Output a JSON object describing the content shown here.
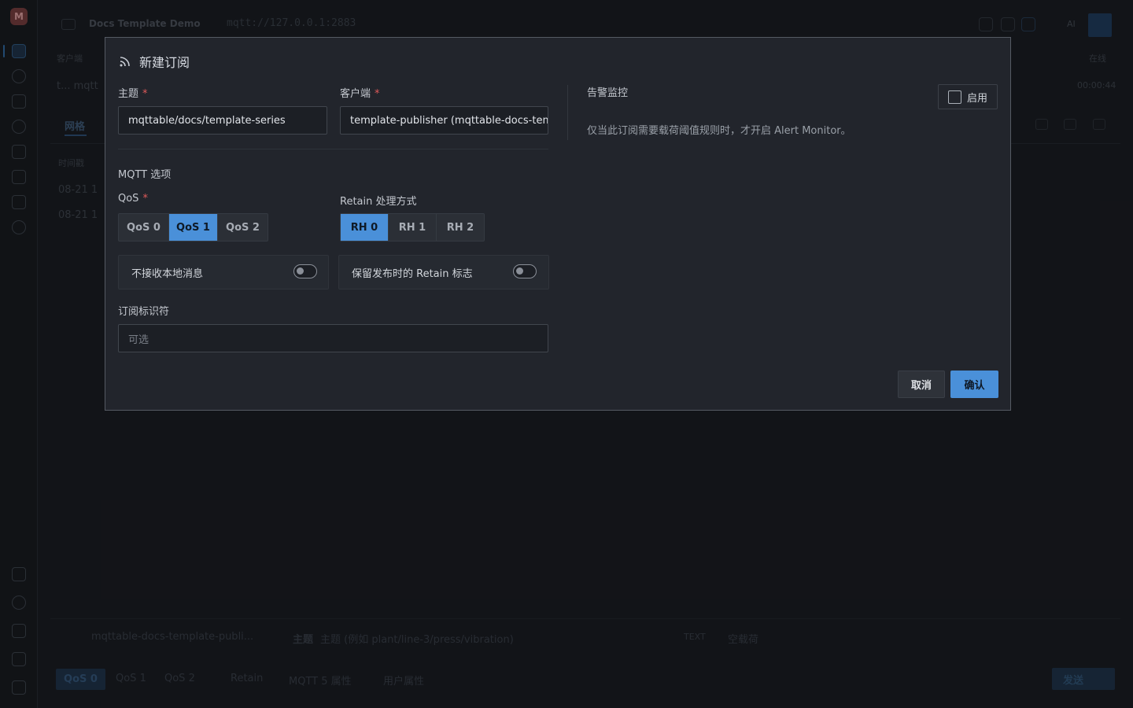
{
  "app": {
    "window_title": "Docs Template Demo",
    "url": "mqtt://127.0.0.1:2883",
    "ai_label": "AI",
    "client_section_label": "客户端",
    "client_short": "t... mqtt",
    "status_label": "在线",
    "elapsed": "00:00:44",
    "tabs": {
      "active": "网格"
    },
    "table": {
      "col_time": "时间戳",
      "row1": "08-21 1",
      "row2": "08-21 1"
    }
  },
  "composer": {
    "client": "mqttable-docs-template-publi...",
    "topic_label": "主题",
    "topic_placeholder": "主题 (例如 plant/line-3/press/vibration)",
    "format": "TEXT",
    "payload_placeholder": "空载荷",
    "qos_options": [
      "QoS 0",
      "QoS 1",
      "QoS 2"
    ],
    "retain": "Retain",
    "mqtt5_props": "MQTT 5 属性",
    "user_props": "用户属性",
    "send": "发送"
  },
  "dialog": {
    "title": "新建订阅",
    "topic": {
      "label": "主题",
      "required_mark": "*",
      "value": "mqttable/docs/template-series"
    },
    "client": {
      "label": "客户端",
      "required_mark": "*",
      "value": "template-publisher (mqttable-docs-tem"
    },
    "mqtt_section": "MQTT 选项",
    "qos": {
      "label": "QoS",
      "required_mark": "*",
      "options": [
        "QoS 0",
        "QoS 1",
        "QoS 2"
      ],
      "selected": "QoS 1"
    },
    "retain_handling": {
      "label": "Retain 处理方式",
      "options": [
        "RH 0",
        "RH 1",
        "RH 2"
      ],
      "selected": "RH 0"
    },
    "no_local": {
      "label": "不接收本地消息",
      "enabled": false
    },
    "retain_as_published": {
      "label": "保留发布时的 Retain 标志",
      "enabled": false
    },
    "sub_id": {
      "label": "订阅标识符",
      "placeholder": "可选"
    },
    "alert": {
      "title": "告警监控",
      "enable_label": "启用",
      "enabled": false,
      "description": "仅当此订阅需要载荷阈值规则时，才开启 Alert Monitor。"
    },
    "cancel": "取消",
    "confirm": "确认"
  },
  "colors": {
    "accent": "#4a90d9",
    "required": "#e05a5a",
    "dialog_bg": "#22252c",
    "page_bg": "#16181d"
  }
}
